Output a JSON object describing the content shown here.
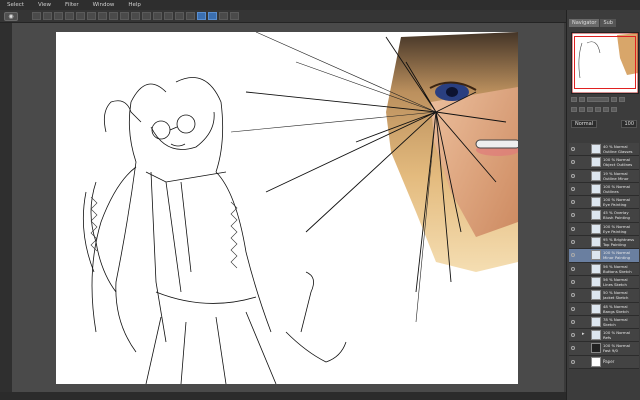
{
  "menu": [
    "Select",
    "View",
    "Filter",
    "Window",
    "Help"
  ],
  "panel": {
    "tabs": [
      "Navigator",
      "Sub"
    ],
    "blend_mode": "Normal",
    "opacity": "100",
    "layers": [
      {
        "l1": "40 % Normal",
        "l2": "Outline Glasses",
        "type": "layer"
      },
      {
        "l1": "100 % Normal",
        "l2": "Object Outlines",
        "type": "layer"
      },
      {
        "l1": "19 % Normal",
        "l2": "Outline Minor",
        "type": "layer"
      },
      {
        "l1": "100 % Normal",
        "l2": "Outlines",
        "type": "layer"
      },
      {
        "l1": "100 % Normal",
        "l2": "Eye Painting",
        "type": "layer"
      },
      {
        "l1": "45 % Overlay",
        "l2": "Blush Painting",
        "type": "layer"
      },
      {
        "l1": "100 % Normal",
        "l2": "Eye Painting",
        "type": "layer"
      },
      {
        "l1": "95 % Brightness",
        "l2": "Top Painting",
        "type": "layer"
      },
      {
        "l1": "100 % Normal",
        "l2": "Minor Painting",
        "type": "layer",
        "selected": true
      },
      {
        "l1": "56 % Normal",
        "l2": "Buttons Sketch",
        "type": "layer"
      },
      {
        "l1": "56 % Normal",
        "l2": "Lines Sketch",
        "type": "layer"
      },
      {
        "l1": "50 % Normal",
        "l2": "Jacket Sketch",
        "type": "layer"
      },
      {
        "l1": "48 % Normal",
        "l2": "Bangs Sketch",
        "type": "layer"
      },
      {
        "l1": "78 % Normal",
        "l2": "Sketch",
        "type": "layer"
      },
      {
        "l1": "100 % Normal",
        "l2": "Refs",
        "type": "folder"
      },
      {
        "l1": "100 % Normal",
        "l2": "Fast 9/0",
        "type": "dark"
      },
      {
        "l1": "Paper",
        "l2": "",
        "type": "paper"
      }
    ]
  },
  "icons": [
    "eye-icon",
    "pen-icon",
    "move-icon",
    "zoom-icon",
    "hand-icon",
    "rotate-icon",
    "folder-icon"
  ],
  "colors": {
    "accent": "#3b6fb0",
    "selected_layer": "#6a7fa0",
    "canvas_bg": "#4a4a4a"
  }
}
